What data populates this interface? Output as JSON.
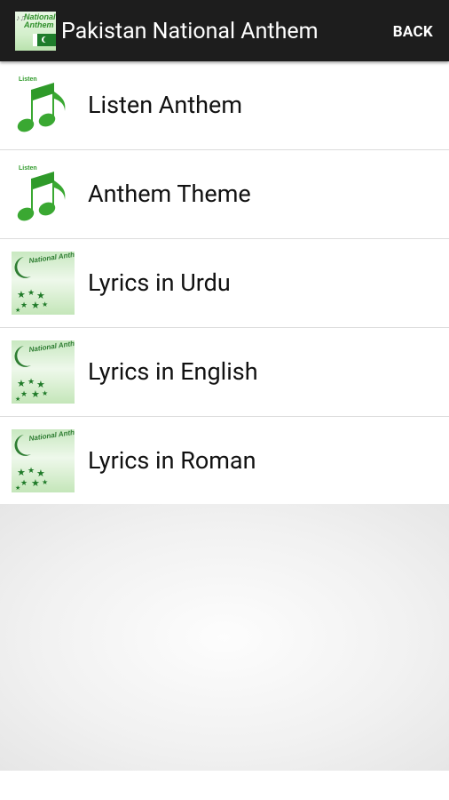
{
  "action_bar": {
    "title": "Pakistan National Anthem",
    "back_label": "BACK",
    "app_icon_text": "National Anthem",
    "background": "#1d1d1d"
  },
  "accent_color": "#2f9a2a",
  "menu": {
    "items": [
      {
        "label": "Listen Anthem",
        "icon": "music-note-icon",
        "icon_tag": "Listen"
      },
      {
        "label": "Anthem Theme",
        "icon": "music-note-icon",
        "icon_tag": "Listen"
      },
      {
        "label": "Lyrics in Urdu",
        "icon": "national-anthem-crescent-icon",
        "icon_text": "National Anthem"
      },
      {
        "label": "Lyrics in English",
        "icon": "national-anthem-crescent-icon",
        "icon_text": "National Anthem"
      },
      {
        "label": "Lyrics in Roman",
        "icon": "national-anthem-crescent-icon",
        "icon_text": "National Anthem"
      }
    ]
  }
}
